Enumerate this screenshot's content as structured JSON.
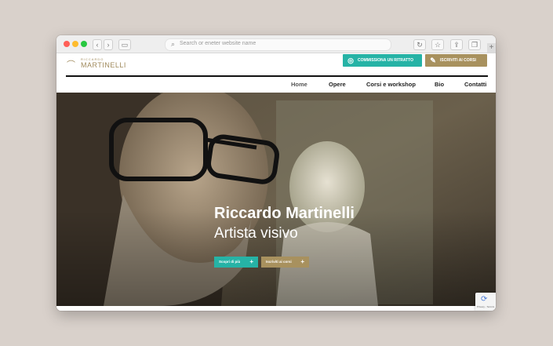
{
  "browser": {
    "address_placeholder": "Search or eneter website name"
  },
  "logo": {
    "small_text": "RICCARDO",
    "big_text": "MARTINELLI"
  },
  "header": {
    "cta_portrait_label": "COMMISSIONA UN RITRATTO",
    "cta_courses_label": "ISCRIVITI AI CORSI"
  },
  "nav": {
    "items": [
      {
        "label": "Home"
      },
      {
        "label": "Opere"
      },
      {
        "label": "Corsi e workshop"
      },
      {
        "label": "Bio"
      },
      {
        "label": "Contatti"
      }
    ]
  },
  "hero": {
    "title": "Riccardo Martinelli",
    "subtitle": "Artista visivo",
    "button_more": "Scopri di più",
    "button_courses": "Iscriviti ai corsi",
    "plus_glyph": "+"
  },
  "recaptcha": {
    "terms": "Privacy - Termini"
  },
  "colors": {
    "teal": "#26b3a6",
    "gold": "#a8915e",
    "background": "#d9d1cb"
  }
}
